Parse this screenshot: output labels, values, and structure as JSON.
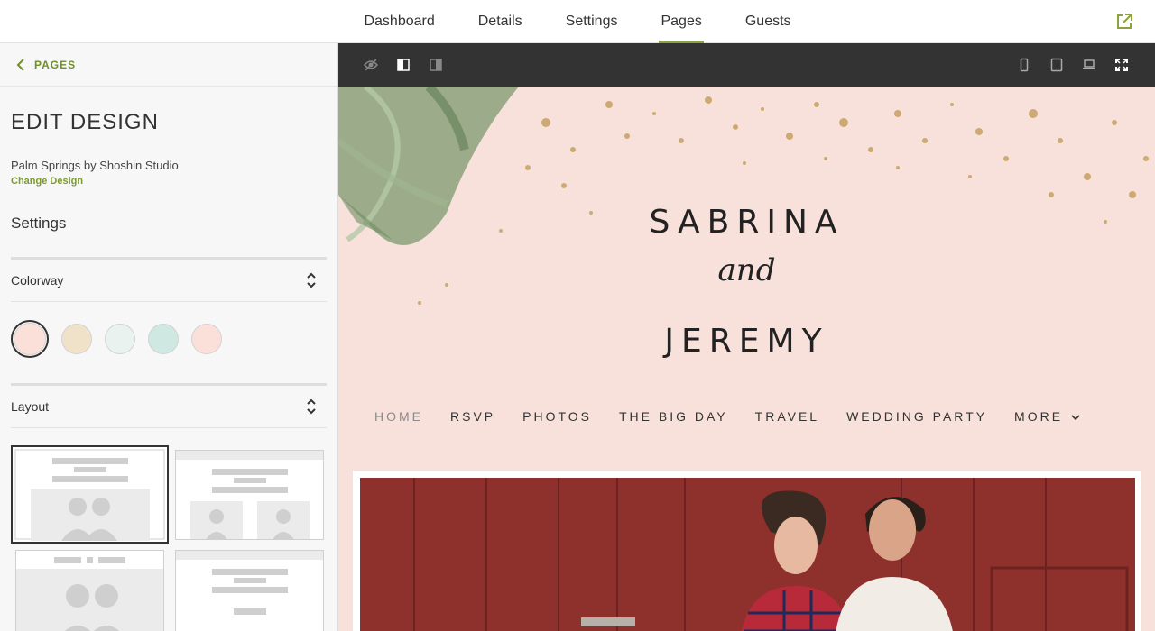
{
  "topnav": {
    "tabs": [
      {
        "label": "Dashboard",
        "active": false
      },
      {
        "label": "Details",
        "active": false
      },
      {
        "label": "Settings",
        "active": false
      },
      {
        "label": "Pages",
        "active": true
      },
      {
        "label": "Guests",
        "active": false
      }
    ],
    "external_icon": "external-link-icon",
    "accent": "#8aa33c"
  },
  "sidebar": {
    "back_label": "PAGES",
    "title": "EDIT DESIGN",
    "design_name": "Palm Springs by Shoshin Studio",
    "change_design": "Change Design",
    "settings_heading": "Settings",
    "colorway": {
      "label": "Colorway",
      "swatches": [
        "#fbe0da",
        "#efe2c8",
        "#e9f2ee",
        "#cfe8e1",
        "#fbe0da"
      ],
      "selected_index": 0
    },
    "layout": {
      "label": "Layout",
      "selected_index": 0
    }
  },
  "toolbar": {
    "left_icons": [
      "hide-icon",
      "sidebar-left-icon",
      "sidebar-right-icon"
    ],
    "right_icons": [
      "phone-icon",
      "tablet-icon",
      "laptop-icon",
      "fullscreen-icon"
    ]
  },
  "preview": {
    "name1": "SABRINA",
    "and": "and",
    "name2": "JEREMY",
    "menu": [
      "HOME",
      "RSVP",
      "PHOTOS",
      "THE BIG DAY",
      "TRAVEL",
      "WEDDING PARTY",
      "MORE"
    ],
    "background": "#f8e1da"
  }
}
